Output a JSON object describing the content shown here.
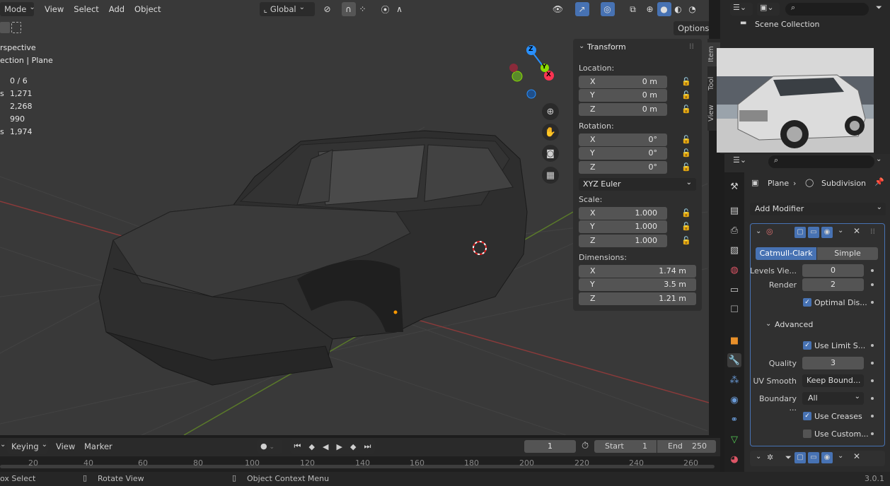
{
  "header": {
    "mode": "Mode",
    "menus": [
      "View",
      "Select",
      "Add",
      "Object"
    ],
    "orientation": "Global",
    "options": "Options"
  },
  "overlay": {
    "view_name": "rspective",
    "collection": "ection | Plane",
    "stats": [
      {
        "label": "",
        "value": "0 / 6"
      },
      {
        "label": "s",
        "value": "1,271"
      },
      {
        "label": "",
        "value": "2,268"
      },
      {
        "label": "",
        "value": "990"
      },
      {
        "label": "s",
        "value": "1,974"
      }
    ]
  },
  "gizmo": {
    "z": "Z",
    "y": "Y",
    "x": "X"
  },
  "npanel": {
    "title": "Transform",
    "location_label": "Location:",
    "location": [
      {
        "axis": "X",
        "value": "0 m"
      },
      {
        "axis": "Y",
        "value": "0 m"
      },
      {
        "axis": "Z",
        "value": "0 m"
      }
    ],
    "rotation_label": "Rotation:",
    "rotation": [
      {
        "axis": "X",
        "value": "0°"
      },
      {
        "axis": "Y",
        "value": "0°"
      },
      {
        "axis": "Z",
        "value": "0°"
      }
    ],
    "rotation_mode": "XYZ Euler",
    "scale_label": "Scale:",
    "scale": [
      {
        "axis": "X",
        "value": "1.000"
      },
      {
        "axis": "Y",
        "value": "1.000"
      },
      {
        "axis": "Z",
        "value": "1.000"
      }
    ],
    "dimensions_label": "Dimensions:",
    "dimensions": [
      {
        "axis": "X",
        "value": "1.74 m"
      },
      {
        "axis": "Y",
        "value": "3.5 m"
      },
      {
        "axis": "Z",
        "value": "1.21 m"
      }
    ],
    "tabs": [
      "Item",
      "Tool",
      "View"
    ]
  },
  "outliner": {
    "scene_collection": "Scene Collection"
  },
  "properties": {
    "breadcrumb_object": "Plane",
    "breadcrumb_modifier": "Subdivision",
    "add_modifier": "Add Modifier",
    "catmull": "Catmull-Clark",
    "simple": "Simple",
    "levels_label": "Levels Vie...",
    "levels_value": "0",
    "render_label": "Render",
    "render_value": "2",
    "optimal": "Optimal Dis...",
    "advanced": "Advanced",
    "use_limit": "Use Limit S...",
    "quality_label": "Quality",
    "quality_value": "3",
    "uv_smooth_label": "UV Smooth",
    "uv_smooth_value": "Keep Bound...",
    "boundary_label": "Boundary ...",
    "boundary_value": "All",
    "use_creases": "Use Creases",
    "use_custom": "Use Custom..."
  },
  "timeline": {
    "keying": "Keying",
    "view": "View",
    "marker": "Marker",
    "current_frame": "1",
    "start_label": "Start",
    "start_value": "1",
    "end_label": "End",
    "end_value": "250",
    "ticks": [
      "20",
      "40",
      "60",
      "80",
      "100",
      "120",
      "140",
      "160",
      "180",
      "200",
      "220",
      "240",
      "260"
    ]
  },
  "status": {
    "select": "ox Select",
    "rotate": "Rotate View",
    "context": "Object Context Menu",
    "version": "3.0.1"
  },
  "colors": {
    "accent": "#4772b3",
    "x_axis": "#ff3352",
    "y_axis": "#8bdc00",
    "z_axis": "#2890ff"
  }
}
